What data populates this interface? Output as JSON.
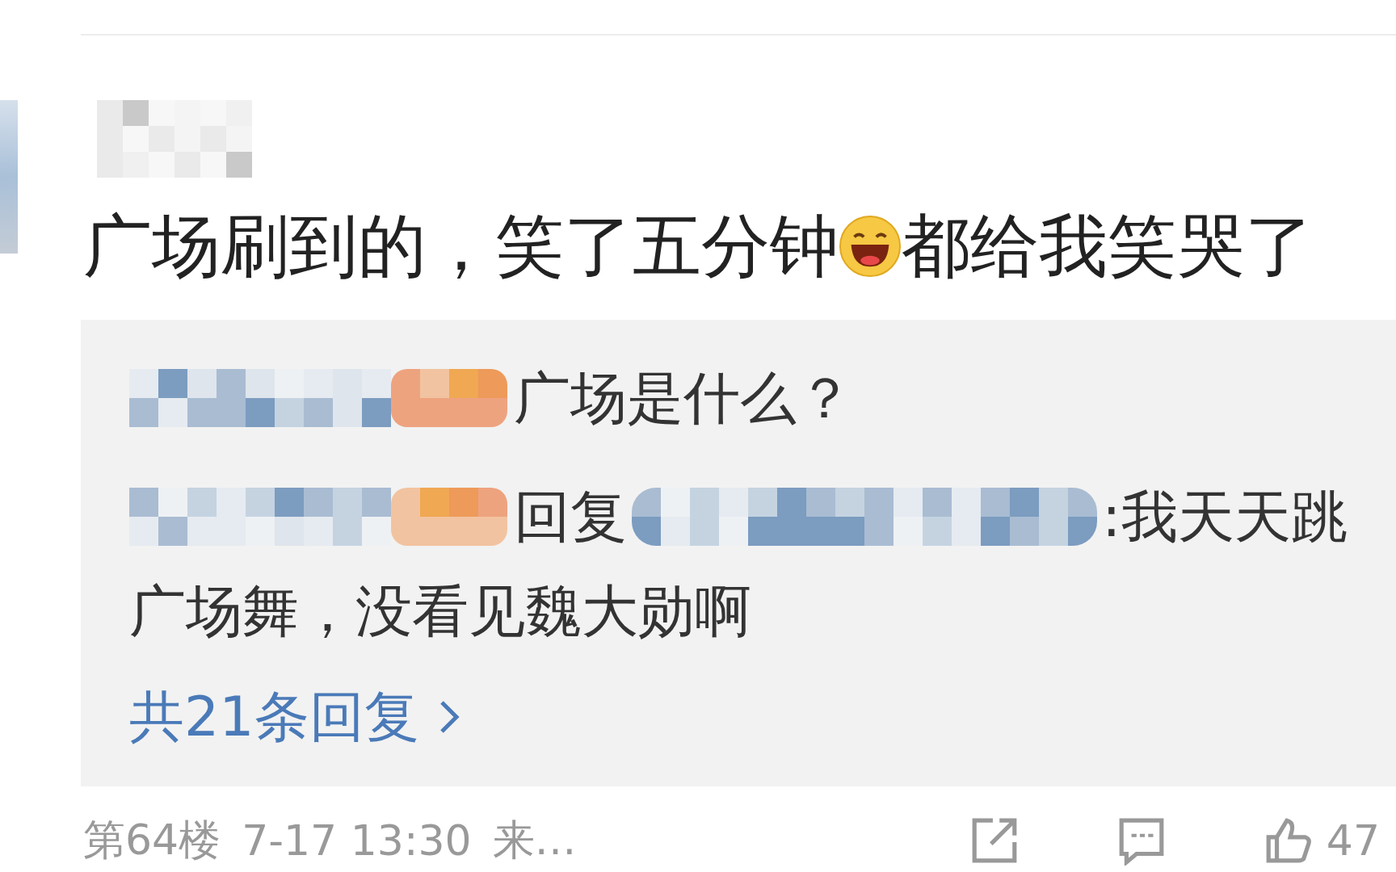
{
  "comment": {
    "text_before_emoji": "广场刷到的，笑了五分钟",
    "text_after_emoji": "都给我笑哭了"
  },
  "replies": [
    {
      "kind": "comment",
      "text": "广场是什么？"
    },
    {
      "kind": "reply",
      "reply_word": "回复",
      "text": ":我天天跳",
      "text_continued": "广场舞，没看见魏大勋啊"
    }
  ],
  "more_replies": "共21条回复",
  "footer": {
    "floor": "第64楼",
    "time": "7-17 13:30",
    "source": "来…",
    "likes": "47"
  }
}
